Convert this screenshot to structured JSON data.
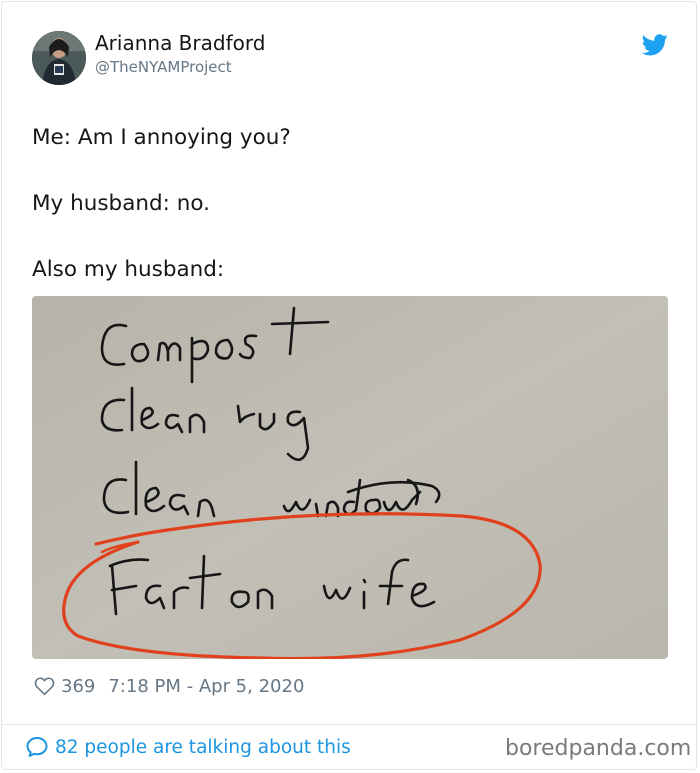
{
  "tweet": {
    "author_name": "Arianna Bradford",
    "author_handle": "@TheNYAMProject",
    "lines": [
      "Me: Am I annoying you?",
      "My husband: no.",
      "Also my husband:"
    ],
    "likes": "369",
    "timestamp": "7:18 PM - Apr 5, 2020",
    "conversation": "82 people are talking about this",
    "brand_color": "#1da1f2",
    "icons": {
      "platform": "twitter-bird-icon",
      "like": "heart-outline-icon",
      "reply": "speech-bubble-icon"
    }
  },
  "note_image": {
    "handwritten_lines": [
      "Compost",
      "Clean rug",
      "Clean window",
      "Fart on wife"
    ],
    "circle_color": "#e0401c"
  },
  "watermark": "boredpanda.com"
}
